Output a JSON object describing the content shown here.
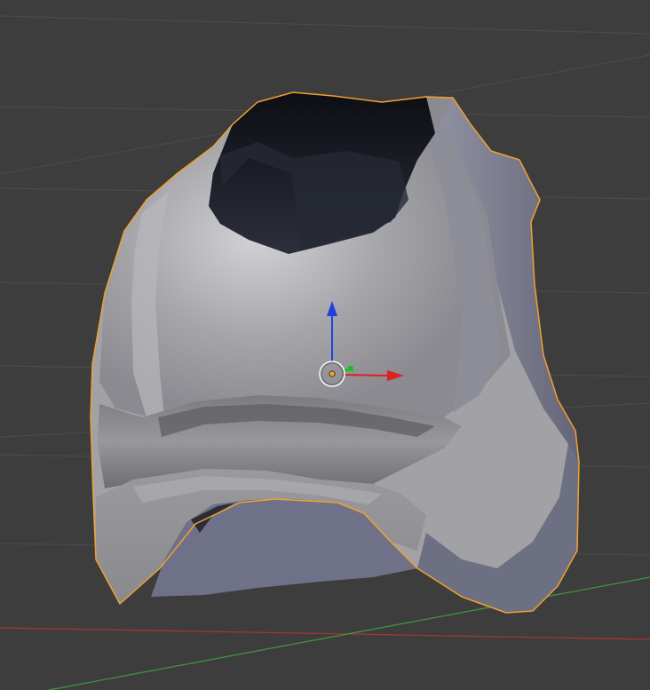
{
  "viewport": {
    "background_color": "#3d3d3d",
    "grid_line_color": "#4a4a4a",
    "x_axis_color": "#a83434",
    "y_axis_color": "#3f9a3f"
  },
  "object": {
    "selected": true,
    "selection_outline_color": "#f0a030",
    "shading": "solid"
  },
  "manipulator": {
    "type": "translate",
    "x_axis_color": "#e02020",
    "y_axis_color": "#20c020",
    "z_axis_color": "#2040e0",
    "origin_dot_color": "#f0a030"
  },
  "icons": [
    "3d-cursor-icon",
    "object-origin-icon",
    "translate-gizmo-icon"
  ]
}
